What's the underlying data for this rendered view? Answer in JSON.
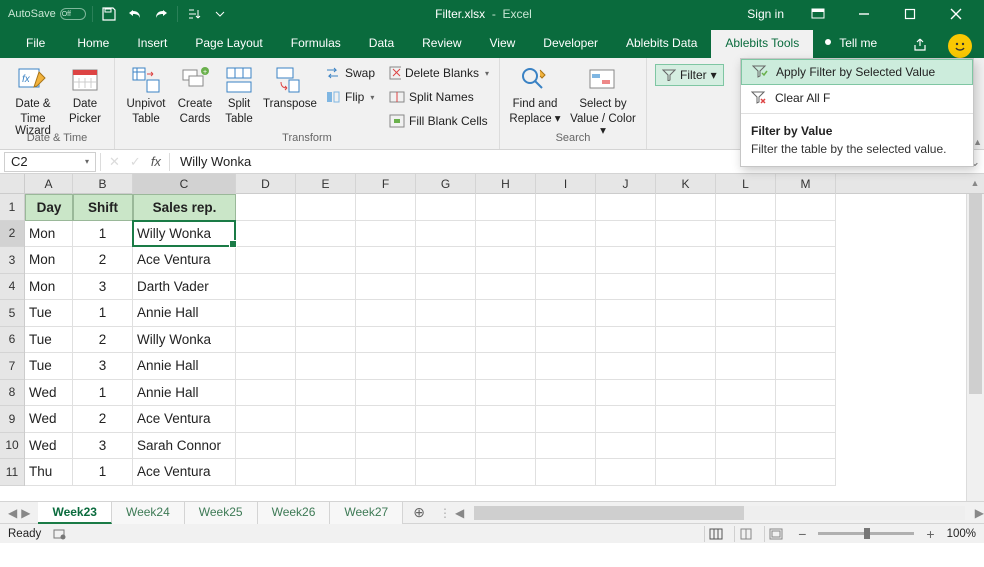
{
  "titlebar": {
    "autosave": "AutoSave",
    "autosave_state": "Off",
    "filename": "Filter.xlsx",
    "appname": "Excel",
    "signin": "Sign in"
  },
  "tabs": {
    "file": "File",
    "items": [
      "Home",
      "Insert",
      "Page Layout",
      "Formulas",
      "Data",
      "Review",
      "View",
      "Developer",
      "Ablebits Data",
      "Ablebits Tools"
    ],
    "active_index": 9,
    "tellme": "Tell me"
  },
  "ribbon": {
    "groups": {
      "datetime": {
        "label": "Date & Time",
        "datetime_wizard_l1": "Date &",
        "datetime_wizard_l2": "Time Wizard",
        "date_picker_l1": "Date",
        "date_picker_l2": "Picker"
      },
      "transform": {
        "label": "Transform",
        "unpivot_l1": "Unpivot",
        "unpivot_l2": "Table",
        "create_cards_l1": "Create",
        "create_cards_l2": "Cards",
        "split_table_l1": "Split",
        "split_table_l2": "Table",
        "transpose": "Transpose",
        "swap": "Swap",
        "flip": "Flip",
        "delete_blanks": "Delete Blanks",
        "split_names": "Split Names",
        "fill_blank": "Fill Blank Cells"
      },
      "search": {
        "label": "Search",
        "find_replace_l1": "Find and",
        "find_replace_l2": "Replace",
        "select_l1": "Select by",
        "select_l2": "Value / Color"
      },
      "filter": {
        "button": "Filter",
        "apply": "Apply Filter by Selected Value",
        "clear": "Clear All F",
        "tip_title": "Filter by Value",
        "tip_body": "Filter the table by the selected value."
      }
    }
  },
  "namebox": "C2",
  "formula_value": "Willy Wonka",
  "colheads": [
    "A",
    "B",
    "C",
    "D",
    "E",
    "F",
    "G",
    "H",
    "I",
    "J",
    "K",
    "L",
    "M"
  ],
  "rownums": [
    1,
    2,
    3,
    4,
    5,
    6,
    7,
    8,
    9,
    10,
    11
  ],
  "headers": {
    "A": "Day",
    "B": "Shift",
    "C": "Sales rep."
  },
  "rows": [
    {
      "day": "Mon",
      "shift": 1,
      "rep": "Willy Wonka"
    },
    {
      "day": "Mon",
      "shift": 2,
      "rep": "Ace Ventura"
    },
    {
      "day": "Mon",
      "shift": 3,
      "rep": "Darth Vader"
    },
    {
      "day": "Tue",
      "shift": 1,
      "rep": "Annie Hall"
    },
    {
      "day": "Tue",
      "shift": 2,
      "rep": "Willy Wonka"
    },
    {
      "day": "Tue",
      "shift": 3,
      "rep": "Annie Hall"
    },
    {
      "day": "Wed",
      "shift": 1,
      "rep": "Annie Hall"
    },
    {
      "day": "Wed",
      "shift": 2,
      "rep": "Ace Ventura"
    },
    {
      "day": "Wed",
      "shift": 3,
      "rep": "Sarah Connor"
    },
    {
      "day": "Thu",
      "shift": 1,
      "rep": "Ace Ventura"
    }
  ],
  "sheets": {
    "items": [
      "Week23",
      "Week24",
      "Week25",
      "Week26",
      "Week27"
    ],
    "active_index": 0
  },
  "status": {
    "ready": "Ready",
    "zoom": "100%"
  }
}
